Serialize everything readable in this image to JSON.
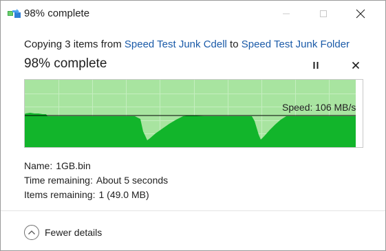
{
  "window": {
    "title": "98% complete",
    "icons": {
      "app": "copy-arrow-icon",
      "minimize": "minimize-icon",
      "maximize": "maximize-icon",
      "close": "close-icon"
    }
  },
  "header": {
    "copy_prefix": "Copying 3 items from ",
    "source": "Speed Test Junk Cdell",
    "to_word": " to ",
    "destination": "Speed Test Junk Folder",
    "percent_title": "98% complete"
  },
  "controls": {
    "pause_icon": "pause-icon",
    "stop_icon": "close-icon"
  },
  "graph": {
    "speed_label": "Speed: 106 MB/s",
    "progress": 0.98,
    "colors": {
      "done_bg": "#a8e4a0",
      "fill": "#12b52b",
      "grid": "#c5eec0",
      "speed_line": "#000000"
    }
  },
  "details": {
    "name_label": "Name:",
    "name_value": "1GB.bin",
    "time_label": "Time remaining:",
    "time_value": "About 5 seconds",
    "items_label": "Items remaining:",
    "items_value": "1 (49.0 MB)"
  },
  "footer": {
    "fewer_details": "Fewer details",
    "chevron_icon": "chevron-up-icon"
  }
}
